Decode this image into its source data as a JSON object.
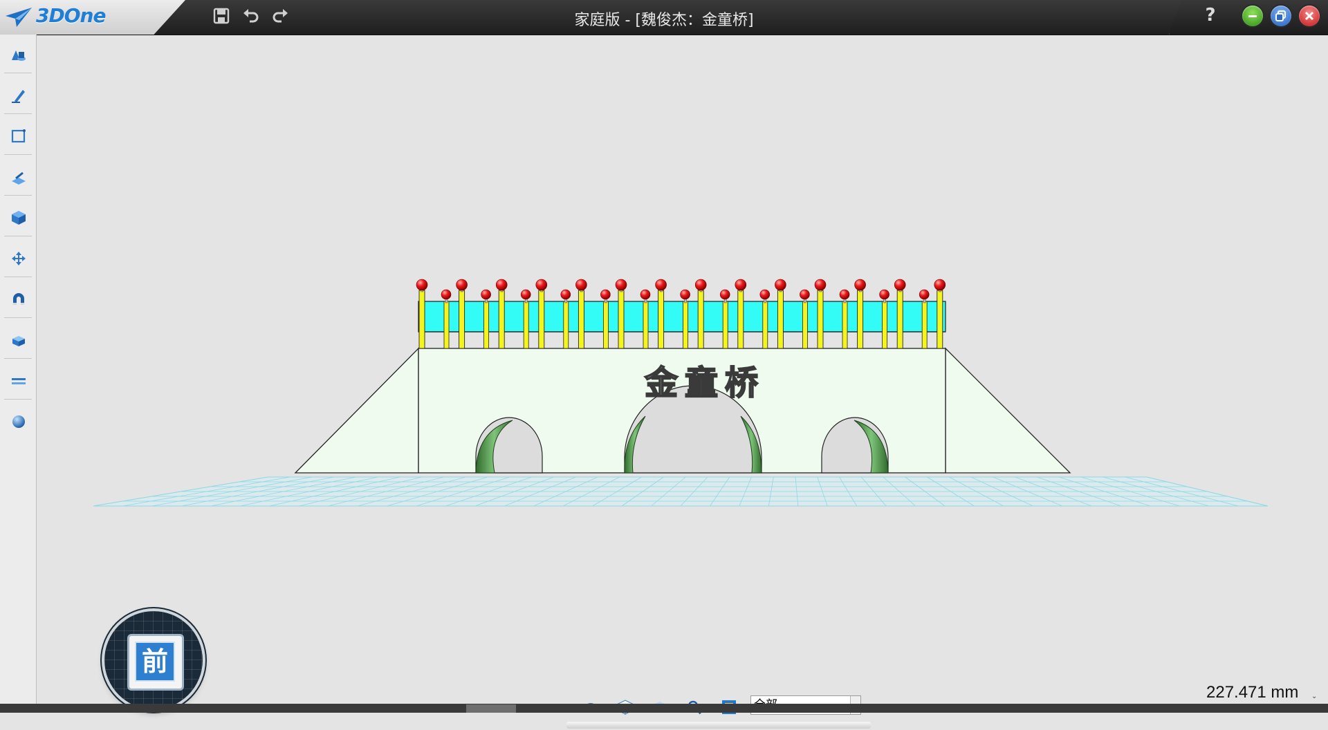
{
  "app": {
    "name": "3DOne",
    "window_title": "家庭版 - [魏俊杰：金童桥]"
  },
  "titlebar": {
    "quick_actions": [
      {
        "name": "save",
        "icon": "save-icon"
      },
      {
        "name": "undo",
        "icon": "undo-icon"
      },
      {
        "name": "redo",
        "icon": "redo-icon"
      }
    ],
    "help_label": "?",
    "window_controls": [
      {
        "name": "minimize",
        "icon": "minimize-icon",
        "color": "#3aa320"
      },
      {
        "name": "restore",
        "icon": "restore-icon",
        "color": "#2f74d0"
      },
      {
        "name": "close",
        "icon": "close-icon",
        "color": "#d62a2a"
      }
    ]
  },
  "left_toolbar": [
    {
      "name": "basic-solid",
      "icon": "solid-shapes-icon"
    },
    {
      "name": "sketch",
      "icon": "pencil-sketch-icon"
    },
    {
      "name": "sketch-edit",
      "icon": "rectangle-sketch-icon"
    },
    {
      "name": "feature",
      "icon": "extrude-icon"
    },
    {
      "name": "special-feature",
      "icon": "cube-icon"
    },
    {
      "name": "basic-edit",
      "icon": "move-arrows-icon"
    },
    {
      "name": "combine",
      "icon": "magnet-icon"
    },
    {
      "name": "auto-snap",
      "icon": "stacked-box-icon"
    },
    {
      "name": "distance-measure",
      "icon": "ruler-icon"
    },
    {
      "name": "material-render",
      "icon": "sphere-icon"
    }
  ],
  "model": {
    "bridge_name_text": "金童桥",
    "colors": {
      "deck": "#33fbf6",
      "posts": "#f5f51e",
      "finials": "#e01515",
      "wall": "#eefbee",
      "arch_inner": "#4f9b4a",
      "ground_grid": "#8fd7e6"
    }
  },
  "view_cube": {
    "face_label": "前"
  },
  "bottom_toolbar": {
    "icons": [
      {
        "name": "show-hide",
        "icon": "eye-icon"
      },
      {
        "name": "wireframe",
        "icon": "wire-cube-icon"
      },
      {
        "name": "shaded",
        "icon": "shaded-cube-icon"
      },
      {
        "name": "zoom",
        "icon": "magnifier-icon"
      },
      {
        "name": "fit",
        "icon": "fit-view-icon"
      }
    ],
    "filter_value": "全部"
  },
  "readout": {
    "value": "227.471 mm"
  }
}
